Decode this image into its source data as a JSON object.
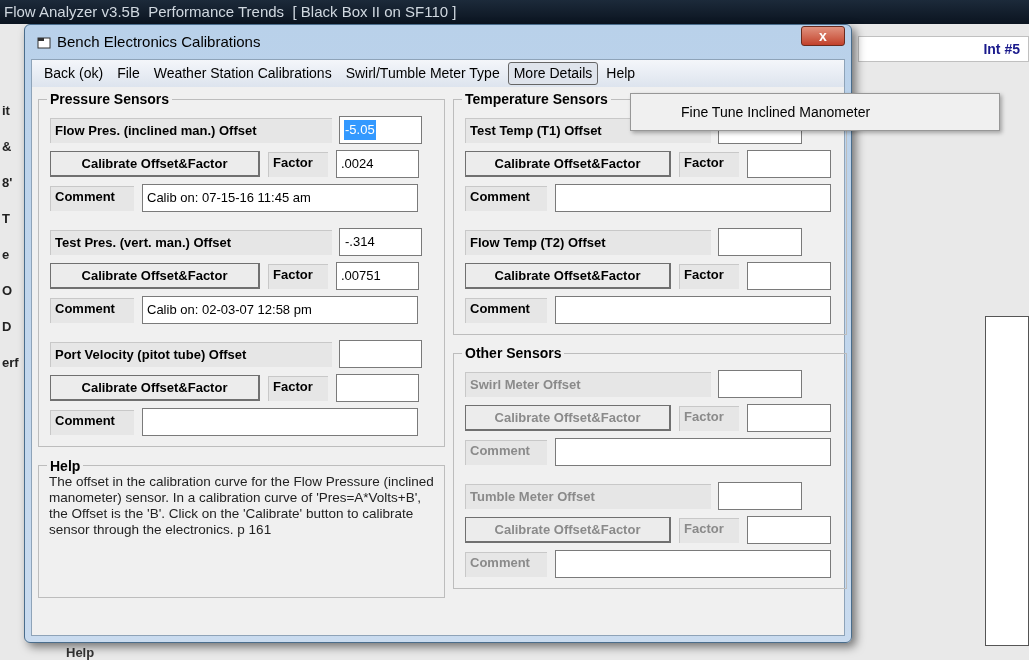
{
  "app": {
    "title": "Flow Analyzer v3.5B  Performance Trends  [ Black Box II on SF110 ]",
    "edge_fragments": [
      "it",
      "&",
      "8'",
      "T",
      "e",
      "O",
      "D",
      "erf"
    ],
    "int_label": "Int #5",
    "help_label": "Help"
  },
  "dialog": {
    "title": "Bench Electronics Calibrations",
    "close": "x",
    "menu": [
      {
        "label": "Back (ok)",
        "selected": false
      },
      {
        "label": "File",
        "selected": false
      },
      {
        "label": "Weather Station Calibrations",
        "selected": false
      },
      {
        "label": "Swirl/Tumble Meter Type",
        "selected": false
      },
      {
        "label": "More Details",
        "selected": true
      },
      {
        "label": "Help",
        "selected": false
      }
    ],
    "dropdown": {
      "items": [
        "Fine Tune Inclined Manometer"
      ]
    },
    "groups": [
      {
        "title": "Pressure Sensors",
        "sensors": [
          {
            "label": "Flow Pres. (inclined man.) Offset",
            "value": "-5.05",
            "value_highlighted": true,
            "button": "Calibrate Offset&Factor",
            "factor_label": "Factor",
            "factor": ".0024",
            "comment_label": "Comment",
            "comment": "Calib on: 07-15-16  11:45 am",
            "disabled": false
          },
          {
            "label": "Test Pres. (vert. man.) Offset",
            "value": "-.314",
            "value_highlighted": false,
            "button": "Calibrate Offset&Factor",
            "factor_label": "Factor",
            "factor": ".00751",
            "comment_label": "Comment",
            "comment": "Calib on: 02-03-07  12:58 pm",
            "disabled": false
          },
          {
            "label": "Port Velocity (pitot tube) Offset",
            "button": "Calibrate Offset&Factor",
            "factor_label": "Factor",
            "comment_label": "Comment",
            "disabled": false
          }
        ]
      },
      {
        "title": "Temperature Sensors",
        "sensors": [
          {
            "label": "Test Temp (T1) Offset",
            "button": "Calibrate Offset&Factor",
            "factor_label": "Factor",
            "comment_label": "Comment",
            "disabled": false
          },
          {
            "label": "Flow Temp (T2) Offset",
            "button": "Calibrate Offset&Factor",
            "factor_label": "Factor",
            "comment_label": "Comment",
            "disabled": false
          }
        ]
      },
      {
        "title": "Other Sensors",
        "sensors": [
          {
            "label": "Swirl Meter Offset",
            "button": "Calibrate Offset&Factor",
            "factor_label": "Factor",
            "comment_label": "Comment",
            "disabled": true
          },
          {
            "label": "Tumble Meter Offset",
            "button": "Calibrate Offset&Factor",
            "factor_label": "Factor",
            "comment_label": "Comment",
            "disabled": true
          }
        ]
      }
    ],
    "help": {
      "title": "Help",
      "text": "The offset in the calibration curve for the Flow Pressure (inclined manometer) sensor.  In a calibration curve of 'Pres=A*Volts+B', the Offset is the 'B'.  Click on the 'Calibrate' button to calibrate sensor through the electronics. p 161"
    }
  }
}
